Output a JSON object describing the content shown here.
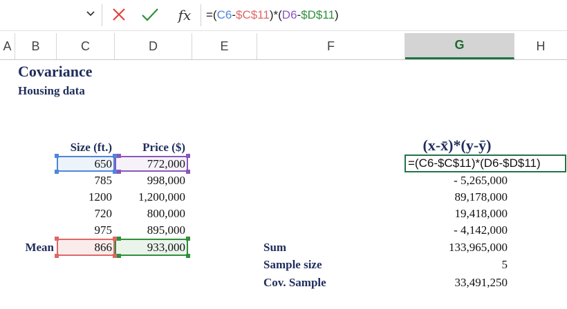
{
  "formula_bar": {
    "dropdown_icon": "chevron-down-icon",
    "cancel_icon": "x-icon",
    "enter_icon": "check-icon",
    "fx_label": "fx",
    "formula_parts": [
      "=(",
      "C6",
      "-",
      "$C$11",
      ")*(",
      "D6",
      "-",
      "$D$11",
      ")"
    ]
  },
  "columns": [
    "A",
    "B",
    "C",
    "D",
    "E",
    "F",
    "G",
    "H"
  ],
  "sheet": {
    "title": "Covariance",
    "subtitle": "Housing data",
    "headers": {
      "size": "Size (ft.)",
      "price": "Price ($)",
      "product": "(x-x̄)*(y-ȳ)"
    },
    "rows": [
      {
        "size": "650",
        "price": "772,000"
      },
      {
        "size": "785",
        "price": "998,000"
      },
      {
        "size": "1200",
        "price": "1,200,000"
      },
      {
        "size": "720",
        "price": "800,000"
      },
      {
        "size": "975",
        "price": "895,000"
      }
    ],
    "mean_label": "Mean",
    "mean_size": "866",
    "mean_price": "933,000",
    "editing_cell": "=(C6-$C$11)*(D6-$D$11)",
    "products": [
      "- 5,265,000",
      "89,178,000",
      "19,418,000",
      "- 4,142,000"
    ],
    "sum_label": "Sum",
    "sum_value": "133,965,000",
    "sample_size_label": "Sample size",
    "sample_size_value": "5",
    "cov_label": "Cov. Sample",
    "cov_value": "33,491,250"
  },
  "colors": {
    "ref_blue": "#4e86d8",
    "ref_purple": "#8a56bd",
    "ref_red": "#e06666",
    "ref_green": "#2f8f3a",
    "excel_green": "#217346",
    "title_navy": "#1f2d5c"
  }
}
